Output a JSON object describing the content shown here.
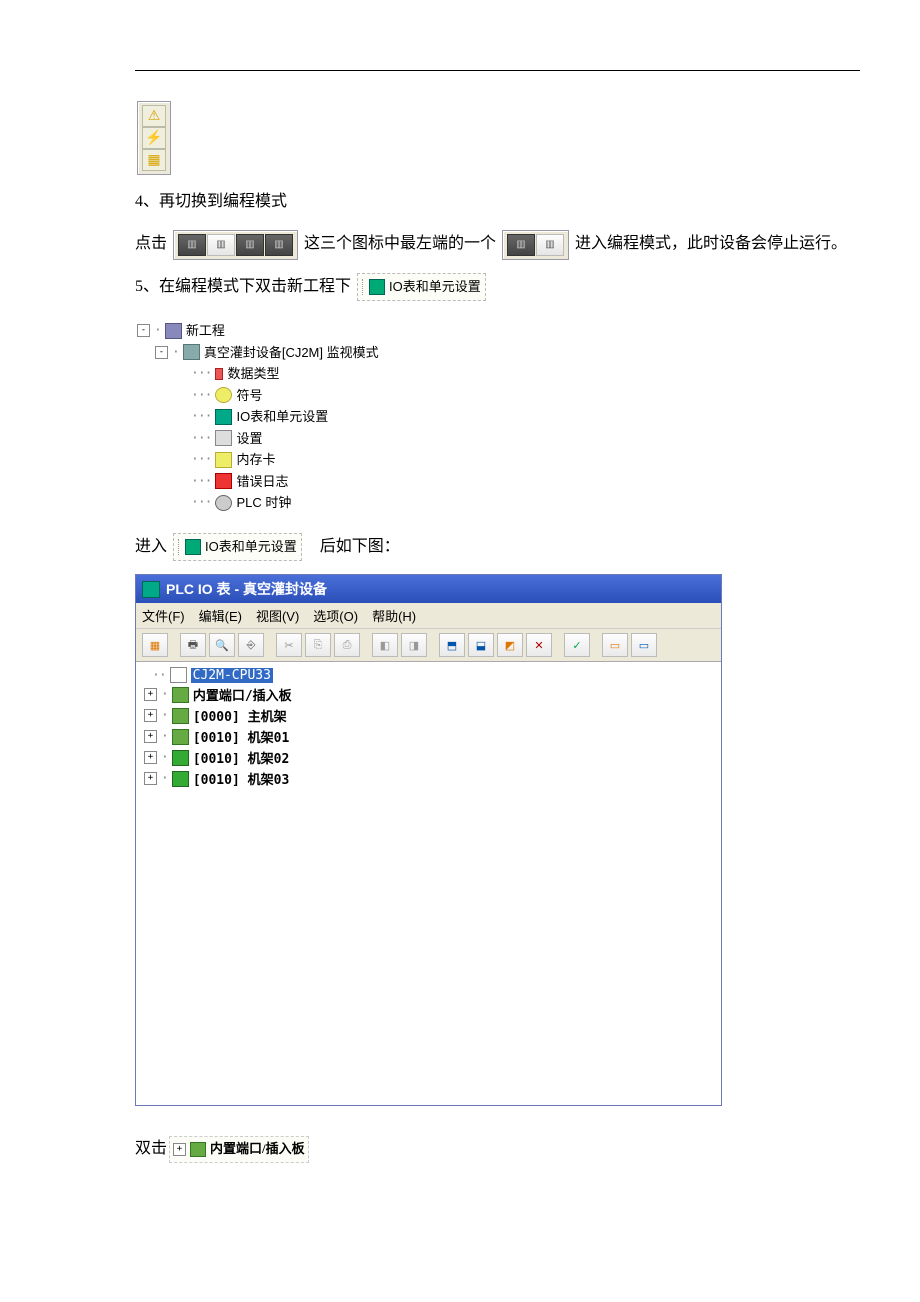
{
  "toolbar_small": {
    "icons": [
      "warning-icon",
      "flash-icon",
      "network-icon"
    ]
  },
  "step4_text": "4、再切换到编程模式",
  "para_click": "点击",
  "para_click_mid": "这三个图标中最左端的一个",
  "para_click_end": "进入编程模式，此时设备会停止运行。",
  "step5_text": "5、在编程模式下双击新工程下",
  "io_inline_label": "IO表和单元设置",
  "tree1": {
    "root": "新工程",
    "device": "真空灌封设备[CJ2M] 监视模式",
    "n1": "数据类型",
    "n2": "符号",
    "n3": "IO表和单元设置",
    "n4": "设置",
    "n5": "内存卡",
    "n6": "错误日志",
    "n7": "PLC 时钟"
  },
  "enter_text_pre": "进入",
  "enter_text_post": "后如下图：",
  "io_window": {
    "title": "PLC IO 表 - 真空灌封设备",
    "menu": {
      "file": "文件(F)",
      "edit": "编辑(E)",
      "view": "视图(V)",
      "options": "选项(O)",
      "help": "帮助(H)"
    },
    "tree": {
      "cpu": "CJ2M-CPU33",
      "r0": "内置端口/插入板",
      "r1": "[0000] 主机架",
      "r2": "[0010] 机架01",
      "r3": "[0010] 机架02",
      "r4": "[0010] 机架03"
    }
  },
  "bottom_pre": "双击",
  "bottom_label": "内置端口/插入板"
}
